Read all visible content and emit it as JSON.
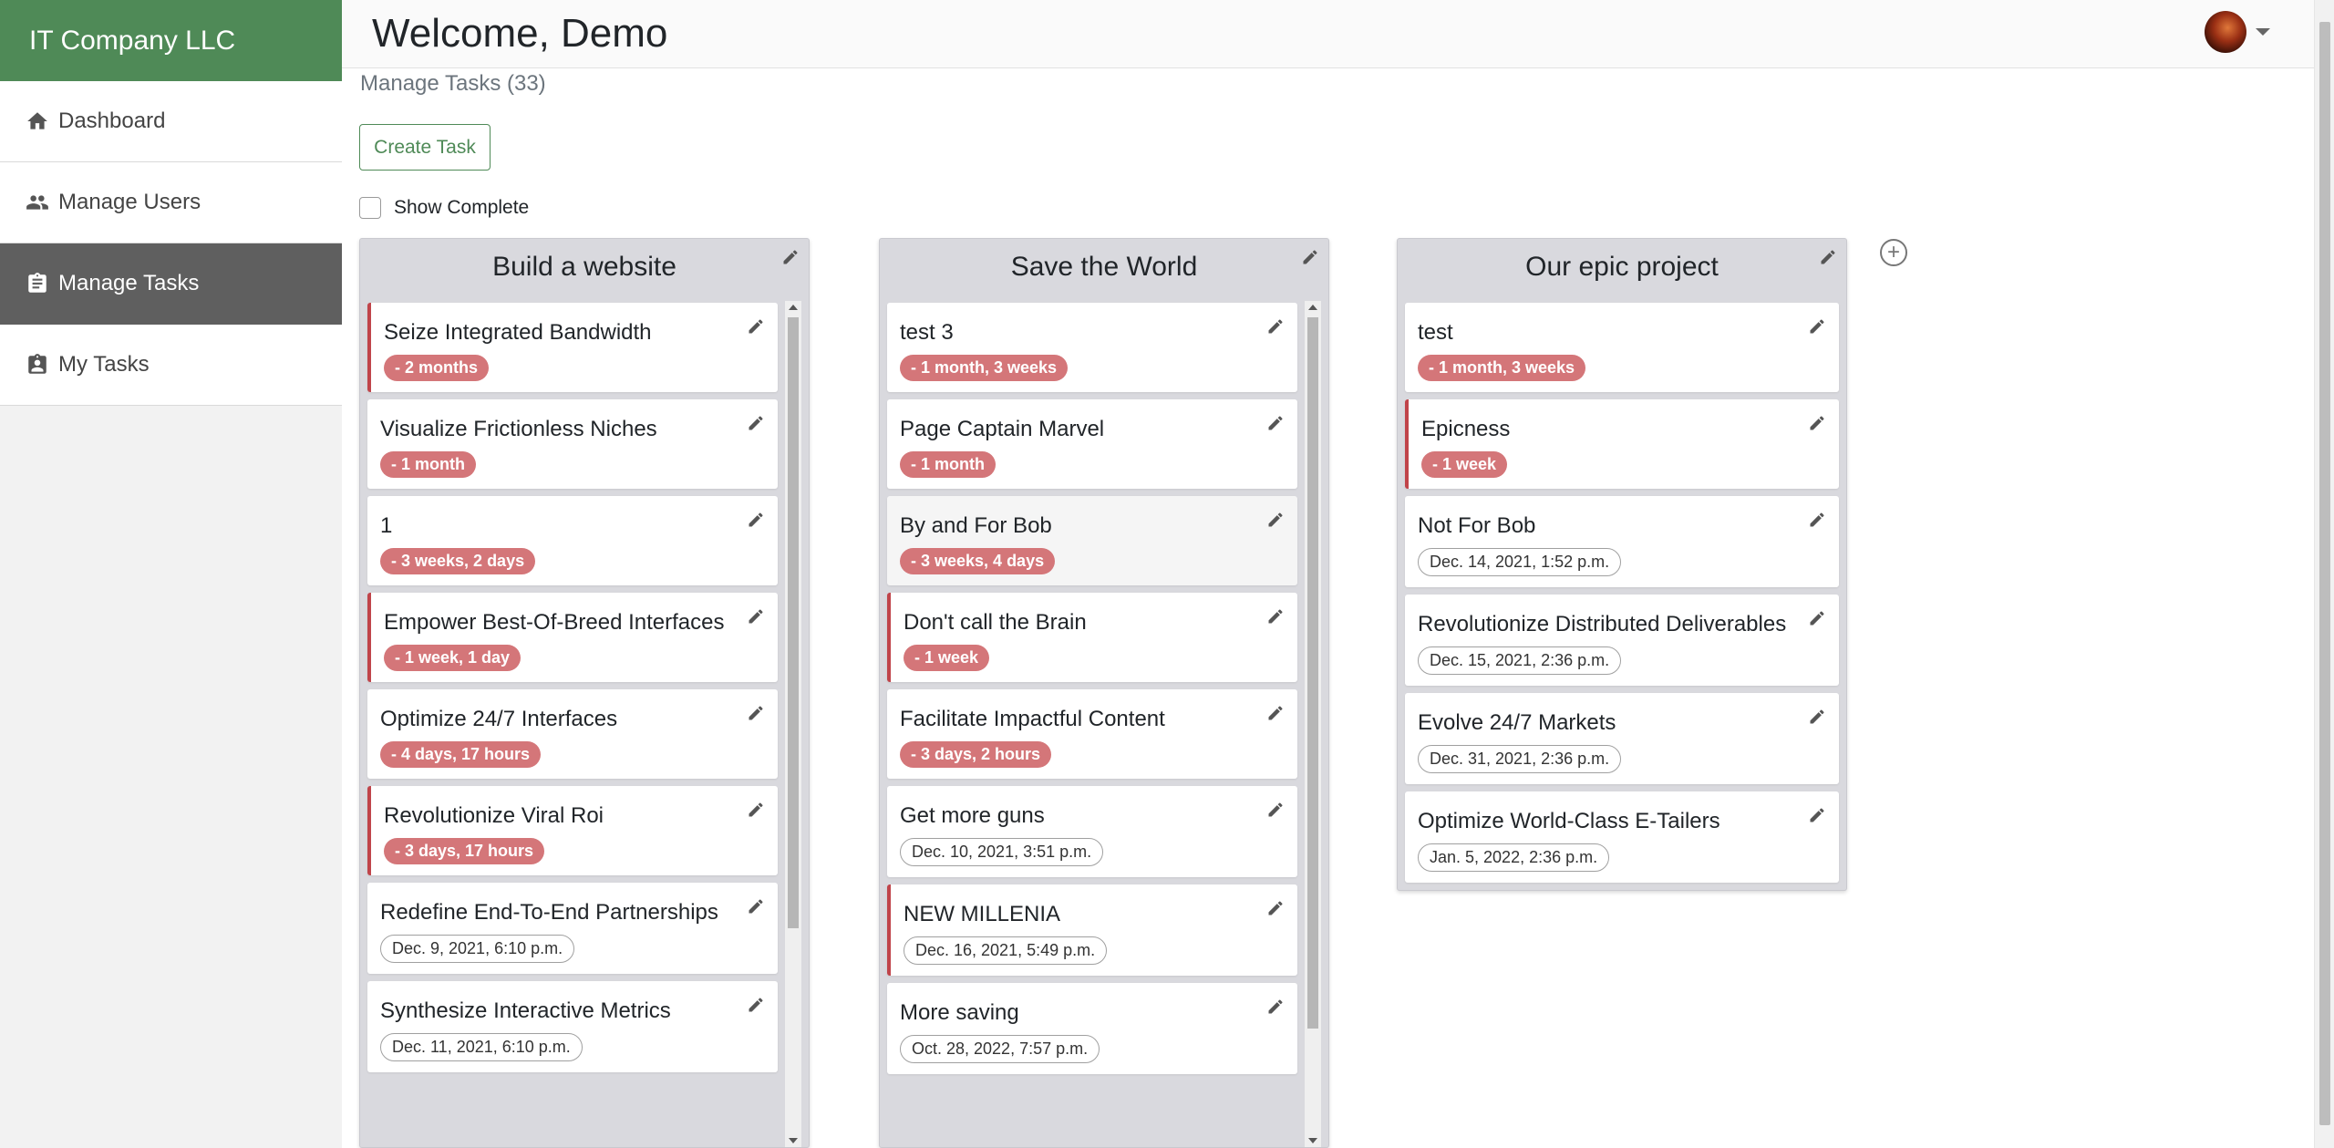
{
  "brand": {
    "name": "IT Company LLC"
  },
  "sidebar": {
    "items": [
      {
        "label": "Dashboard",
        "icon": "home-icon",
        "active": false
      },
      {
        "label": "Manage Users",
        "icon": "users-icon",
        "active": false
      },
      {
        "label": "Manage Tasks",
        "icon": "clipboard-icon",
        "active": true
      },
      {
        "label": "My Tasks",
        "icon": "clipboard-user-icon",
        "active": false
      }
    ]
  },
  "header": {
    "welcome": "Welcome, Demo",
    "avatar": "user-avatar"
  },
  "page": {
    "subtitle": "Manage Tasks (33)",
    "create_label": "Create Task",
    "show_complete_label": "Show Complete",
    "show_complete_checked": false
  },
  "colors": {
    "brand": "#4f8a57",
    "active_nav": "#5f5f5f",
    "overdue_badge": "#d47679",
    "overdue_border": "#c0444a"
  },
  "columns": [
    {
      "title": "Build a website",
      "cards": [
        {
          "title": "Seize Integrated Bandwidth",
          "badge": "- 2 months",
          "kind": "overdue",
          "alert": true
        },
        {
          "title": "Visualize Frictionless Niches",
          "badge": "- 1 month",
          "kind": "overdue",
          "alert": false
        },
        {
          "title": "1",
          "badge": "- 3 weeks, 2 days",
          "kind": "overdue",
          "alert": false
        },
        {
          "title": "Empower Best-Of-Breed Interfaces",
          "badge": "- 1 week, 1 day",
          "kind": "overdue",
          "alert": true
        },
        {
          "title": "Optimize 24/7 Interfaces",
          "badge": "- 4 days, 17 hours",
          "kind": "overdue",
          "alert": false
        },
        {
          "title": "Revolutionize Viral Roi",
          "badge": "- 3 days, 17 hours",
          "kind": "overdue",
          "alert": true
        },
        {
          "title": "Redefine End-To-End Partnerships",
          "badge": "Dec. 9, 2021, 6:10 p.m.",
          "kind": "date",
          "alert": false
        },
        {
          "title": "Synthesize Interactive Metrics",
          "badge": "Dec. 11, 2021, 6:10 p.m.",
          "kind": "date",
          "alert": false
        }
      ]
    },
    {
      "title": "Save the World",
      "cards": [
        {
          "title": "test 3",
          "badge": "- 1 month, 3 weeks",
          "kind": "overdue",
          "alert": false
        },
        {
          "title": "Page Captain Marvel",
          "badge": "- 1 month",
          "kind": "overdue",
          "alert": false
        },
        {
          "title": "By and For Bob",
          "badge": "- 3 weeks, 4 days",
          "kind": "overdue",
          "alert": false,
          "shaded": true
        },
        {
          "title": "Don't call the Brain",
          "badge": "- 1 week",
          "kind": "overdue",
          "alert": true
        },
        {
          "title": "Facilitate Impactful Content",
          "badge": "- 3 days, 2 hours",
          "kind": "overdue",
          "alert": false
        },
        {
          "title": "Get more guns",
          "badge": "Dec. 10, 2021, 3:51 p.m.",
          "kind": "date",
          "alert": false
        },
        {
          "title": "NEW MILLENIA",
          "badge": "Dec. 16, 2021, 5:49 p.m.",
          "kind": "date",
          "alert": true
        },
        {
          "title": "More saving",
          "badge": "Oct. 28, 2022, 7:57 p.m.",
          "kind": "date",
          "alert": false
        }
      ]
    },
    {
      "title": "Our epic project",
      "cards": [
        {
          "title": "test",
          "badge": "- 1 month, 3 weeks",
          "kind": "overdue",
          "alert": false
        },
        {
          "title": "Epicness",
          "badge": "- 1 week",
          "kind": "overdue",
          "alert": true
        },
        {
          "title": "Not For Bob",
          "badge": "Dec. 14, 2021, 1:52 p.m.",
          "kind": "date",
          "alert": false
        },
        {
          "title": "Revolutionize Distributed Deliverables",
          "badge": "Dec. 15, 2021, 2:36 p.m.",
          "kind": "date",
          "alert": false
        },
        {
          "title": "Evolve 24/7 Markets",
          "badge": "Dec. 31, 2021, 2:36 p.m.",
          "kind": "date",
          "alert": false
        },
        {
          "title": "Optimize World-Class E-Tailers",
          "badge": "Jan. 5, 2022, 2:36 p.m.",
          "kind": "date",
          "alert": false
        }
      ]
    }
  ]
}
